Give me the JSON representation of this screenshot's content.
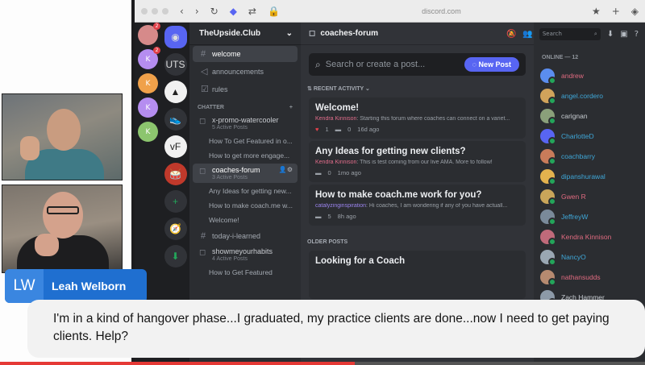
{
  "browser": {
    "url": "discord.com"
  },
  "speaker": {
    "initials": "LW",
    "name": "Leah Welborn"
  },
  "caption": {
    "text": "I'm in a kind of hangover phase...I graduated, my practice clients are done...now I need to get paying clients. Help?"
  },
  "servers": [
    {
      "label": "K",
      "badge": "2"
    },
    {
      "label": "K",
      "badge": ""
    },
    {
      "label": "K",
      "badge": ""
    },
    {
      "label": "K",
      "badge": ""
    }
  ],
  "rail": [
    {
      "label": "UTS"
    },
    {
      "label": "▲"
    },
    {
      "label": "👟"
    },
    {
      "label": "vF"
    },
    {
      "label": "🥁"
    },
    {
      "label": "+"
    },
    {
      "label": "🧭"
    },
    {
      "label": "⬇"
    }
  ],
  "guild": {
    "name": "TheUpside.Club"
  },
  "channels": {
    "top": [
      {
        "name": "welcome",
        "selected": true
      },
      {
        "name": "announcements",
        "selected": false
      },
      {
        "name": "rules",
        "selected": false
      }
    ],
    "category": "CHATTER",
    "list": [
      {
        "kind": "forum",
        "name": "x-promo-watercooler",
        "sub": "5 Active Posts"
      },
      {
        "kind": "thread",
        "name": "How To Get Featured in o..."
      },
      {
        "kind": "thread",
        "name": "How to get more engage..."
      },
      {
        "kind": "forum",
        "name": "coaches-forum",
        "sub": "3 Active Posts",
        "selected": true
      },
      {
        "kind": "thread",
        "name": "Any Ideas for getting new..."
      },
      {
        "kind": "thread",
        "name": "How to make coach.me w..."
      },
      {
        "kind": "thread",
        "name": "Welcome!"
      },
      {
        "kind": "channel",
        "name": "today-i-learned"
      },
      {
        "kind": "forum",
        "name": "showmeyourhabits",
        "sub": "4 Active Posts"
      },
      {
        "kind": "thread",
        "name": "How to Get Featured"
      }
    ]
  },
  "forum": {
    "title": "coaches-forum",
    "search_placeholder": "Search or create a post...",
    "new_post": "New Post",
    "header_search": "Search",
    "recent_label": "RECENT ACTIVITY",
    "older_label": "OLDER POSTS",
    "posts": [
      {
        "title": "Welcome!",
        "author": "Kendra Kinnison",
        "excerpt": ": Starting this forum where coaches can connect on a variet...",
        "reactions": "1",
        "comments": "0",
        "age": "16d ago"
      },
      {
        "title": "Any Ideas for getting new clients?",
        "author": "Kendra Kinnison",
        "excerpt": ": This is test coming from our live AMA. More to follow!",
        "reactions": "",
        "comments": "0",
        "age": "1mo ago"
      },
      {
        "title": "How to make coach.me work for you?",
        "author": "catalyzinginspiration",
        "excerpt": ": Hi coaches, I am wondering if any of you have actuall...",
        "reactions": "",
        "comments": "5",
        "age": "8h ago"
      }
    ],
    "older_posts": [
      {
        "title": "Looking for a Coach"
      }
    ]
  },
  "members": {
    "heading": "ONLINE — 12",
    "list": [
      {
        "name": "andrew",
        "color": "#e06b80"
      },
      {
        "name": "angel.cordero",
        "color": "#3fa8d9"
      },
      {
        "name": "carignan",
        "color": "#c7ccd1"
      },
      {
        "name": "CharlotteD",
        "color": "#3fa8d9"
      },
      {
        "name": "coachbarry",
        "color": "#3fa8d9"
      },
      {
        "name": "dipanshurawal",
        "color": "#3fa8d9"
      },
      {
        "name": "Gwen R",
        "color": "#e06b80"
      },
      {
        "name": "JeffreyW",
        "color": "#3fa8d9"
      },
      {
        "name": "Kendra Kinnison",
        "color": "#e06b80"
      },
      {
        "name": "NancyO",
        "color": "#3fa8d9"
      },
      {
        "name": "nathansudds",
        "color": "#e06b80"
      },
      {
        "name": "Zach Hammer",
        "color": "#c7ccd1"
      }
    ]
  },
  "playback": {
    "progress_fraction": 0.55
  }
}
